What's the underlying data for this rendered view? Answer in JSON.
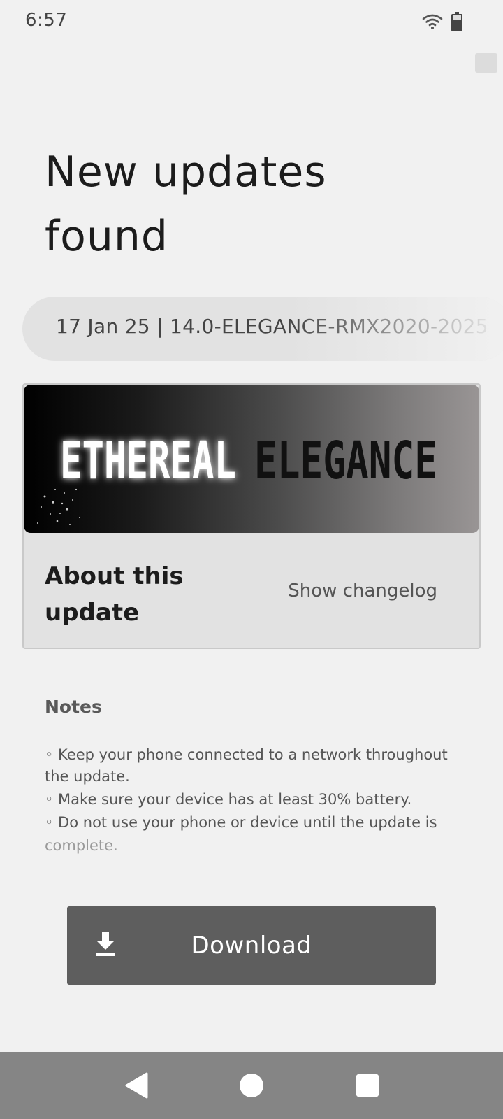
{
  "status_bar": {
    "time": "6:57",
    "icons": [
      "wifi-icon",
      "battery-icon"
    ]
  },
  "header": {
    "title_line1": "New updates",
    "title_line2": "found"
  },
  "version": {
    "text": "17 Jan 25 | 14.0-ELEGANCE-RMX2020-2025"
  },
  "update_card": {
    "banner_word1": "ETHEREAL",
    "banner_word2": "ELEGANCE",
    "about_title": "About this update",
    "changelog_label": "Show changelog"
  },
  "notes": {
    "heading": "Notes",
    "items": [
      "◦ Keep your phone connected to a network throughout the update.",
      "◦ Make sure your device has at least 30% battery.",
      "◦ Do not use your phone or device until the update is"
    ],
    "faded_tail": "complete."
  },
  "download": {
    "label": "Download",
    "icon": "download-icon"
  },
  "nav_bar": {
    "buttons": [
      "back-icon",
      "home-icon",
      "recents-icon"
    ]
  },
  "colors": {
    "background": "#f1f1f1",
    "button": "#5e5e5e",
    "nav_bar": "#858585",
    "card": "#e2e2e2"
  }
}
